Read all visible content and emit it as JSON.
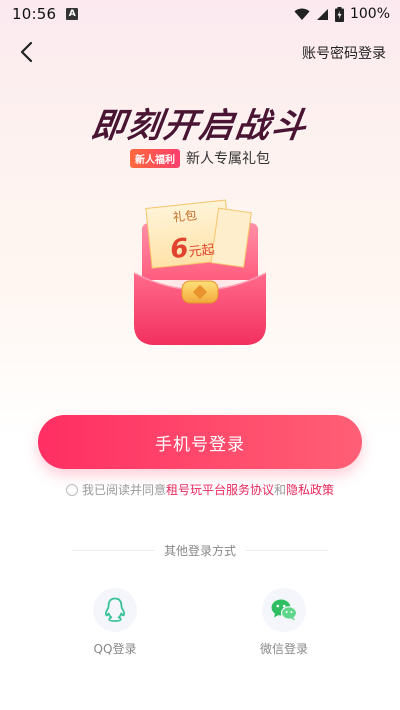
{
  "status_bar": {
    "time": "10:56",
    "notification_icon": "a-app-icon",
    "battery_text": "100%",
    "icons": [
      "wifi-icon",
      "signal-icon",
      "battery-icon"
    ]
  },
  "nav": {
    "back_icon": "chevron-left-icon",
    "alt_login": "账号密码登录"
  },
  "hero": {
    "title": "即刻开启战斗",
    "badge": "新人福利",
    "subtitle": "新人专属礼包"
  },
  "gift": {
    "label": "礼包",
    "amount": "6",
    "unit": "元起",
    "icon": "red-envelope-icon"
  },
  "login": {
    "button_label": "手机号登录",
    "agree_prefix": "我已阅读并同意",
    "agree_link_1": "租号玩平台服务协议",
    "agree_and": "和",
    "agree_link_2": "隐私政策"
  },
  "other_login": {
    "divider_text": "其他登录方式",
    "qq_label": "QQ登录",
    "wechat_label": "微信登录"
  },
  "colors": {
    "accent": "#ff3565",
    "title": "#4a1433",
    "link": "#e8285c"
  }
}
